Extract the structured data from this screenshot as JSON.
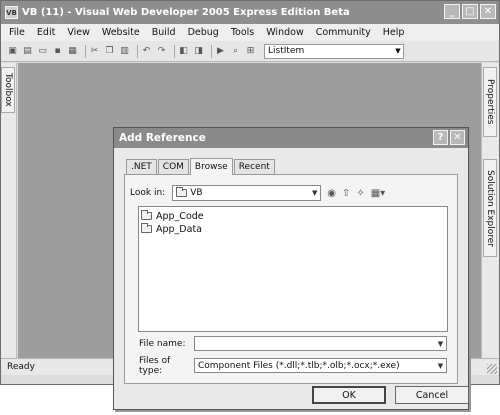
{
  "window": {
    "title": "VB (11) - Visual Web Developer 2005 Express Edition Beta",
    "app_icon_text": "VB"
  },
  "menubar": {
    "items": [
      "File",
      "Edit",
      "View",
      "Website",
      "Build",
      "Debug",
      "Tools",
      "Window",
      "Community",
      "Help"
    ]
  },
  "toolbar": {
    "combo_value": "ListItem"
  },
  "sidebar_left": {
    "toolbox_label": "Toolbox"
  },
  "sidebar_right": {
    "properties_label": "Properties",
    "solution_explorer_label": "Solution Explorer"
  },
  "statusbar": {
    "text": "Ready"
  },
  "dialog": {
    "title": "Add Reference",
    "help_label": "?",
    "close_label": "✕",
    "tabs": [
      ".NET",
      "COM",
      "Browse",
      "Recent"
    ],
    "active_tab": "Browse",
    "look_in_label": "Look in:",
    "look_in_value": "VB",
    "files": [
      "App_Code",
      "App_Data"
    ],
    "file_name_label": "File name:",
    "file_name_value": "",
    "files_of_type_label": "Files of type:",
    "files_of_type_value": "Component Files (*.dll;*.tlb;*.olb;*.ocx;*.exe)",
    "ok_label": "OK",
    "cancel_label": "Cancel"
  },
  "icons": [
    "minimize-icon",
    "maximize-icon",
    "close-icon",
    "new-project-icon",
    "open-icon",
    "save-icon",
    "cut-icon",
    "copy-icon",
    "paste-icon",
    "undo-icon",
    "redo-icon",
    "run-icon",
    "find-icon",
    "back-icon",
    "up-folder-icon",
    "new-folder-icon",
    "views-icon"
  ]
}
